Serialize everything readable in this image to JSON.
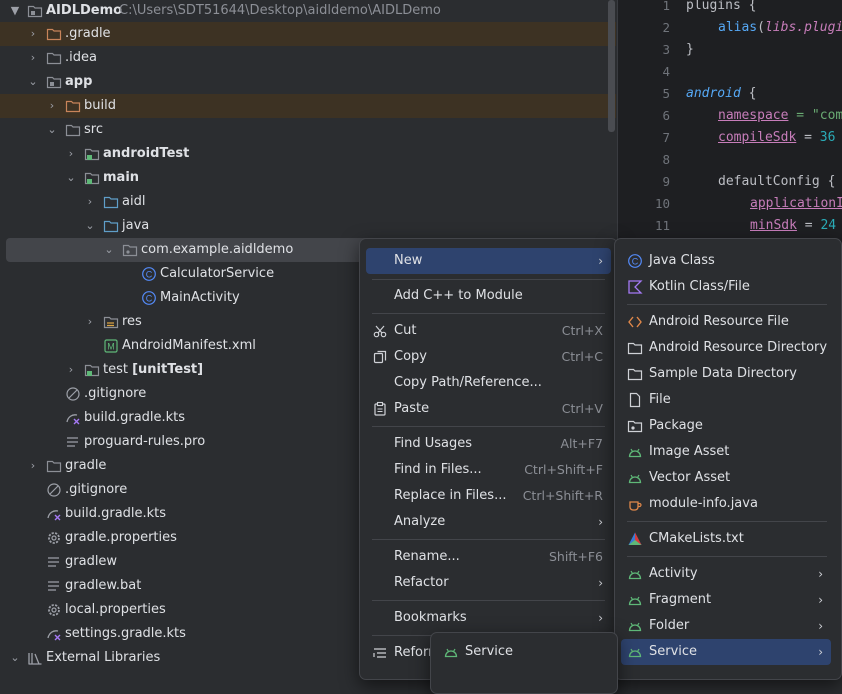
{
  "project_tree": {
    "root": {
      "name": "AIDLDemo",
      "path": "C:\\Users\\SDT51644\\Desktop\\aidldemo\\AIDLDemo"
    },
    "items": [
      {
        "label": ".gradle"
      },
      {
        "label": ".idea"
      },
      {
        "label": "app"
      },
      {
        "label": "build"
      },
      {
        "label": "src"
      },
      {
        "label": "androidTest"
      },
      {
        "label": "main"
      },
      {
        "label": "aidl"
      },
      {
        "label": "java"
      },
      {
        "label": "com.example.aidldemo"
      },
      {
        "label": "CalculatorService"
      },
      {
        "label": "MainActivity"
      },
      {
        "label": "res"
      },
      {
        "label": "AndroidManifest.xml"
      },
      {
        "label": "test",
        "suffix": "[unitTest]"
      },
      {
        "label": ".gitignore"
      },
      {
        "label": "build.gradle.kts"
      },
      {
        "label": "proguard-rules.pro"
      },
      {
        "label": "gradle"
      },
      {
        "label": ".gitignore"
      },
      {
        "label": "build.gradle.kts"
      },
      {
        "label": "gradle.properties"
      },
      {
        "label": "gradlew"
      },
      {
        "label": "gradlew.bat"
      },
      {
        "label": "local.properties"
      },
      {
        "label": "settings.gradle.kts"
      },
      {
        "label": "External Libraries"
      }
    ]
  },
  "editor": {
    "line_numbers": [
      "1",
      "2",
      "3",
      "4",
      "5",
      "6",
      "7",
      "8",
      "9",
      "10",
      "11"
    ],
    "code": {
      "l1": "plugins {",
      "l2_fn": "alias",
      "l2_arg": "libs.plugi",
      "l3": "}",
      "l5": "android",
      "l6_prop": "namespace",
      "l6_val": " = \"com",
      "l7_prop": "compileSdk",
      "l7_val": "36",
      "l9": "defaultConfig {",
      "l10_prop": "applicationI",
      "l11_prop": "minSdk",
      "l11_val": "24"
    }
  },
  "context_menu": {
    "new": "New",
    "add_cpp": "Add C++ to Module",
    "cut": "Cut",
    "cut_sc": "Ctrl+X",
    "copy": "Copy",
    "copy_sc": "Ctrl+C",
    "copy_path": "Copy Path/Reference...",
    "paste": "Paste",
    "paste_sc": "Ctrl+V",
    "find_usages": "Find Usages",
    "find_usages_sc": "Alt+F7",
    "find_in_files": "Find in Files...",
    "find_in_files_sc": "Ctrl+Shift+F",
    "replace_in_files": "Replace in Files...",
    "replace_in_files_sc": "Ctrl+Shift+R",
    "analyze": "Analyze",
    "rename": "Rename...",
    "rename_sc": "Shift+F6",
    "refactor": "Refactor",
    "bookmarks": "Bookmarks",
    "reformat": "Reform"
  },
  "new_submenu": {
    "java_class": "Java Class",
    "kotlin_class": "Kotlin Class/File",
    "android_resource_file": "Android Resource File",
    "android_resource_directory": "Android Resource Directory",
    "sample_data_directory": "Sample Data Directory",
    "file": "File",
    "package": "Package",
    "image_asset": "Image Asset",
    "vector_asset": "Vector Asset",
    "module_info": "module-info.java",
    "cmakelists": "CMakeLists.txt",
    "activity": "Activity",
    "fragment": "Fragment",
    "folder": "Folder",
    "service": "Service"
  },
  "service_submenu": {
    "service": "Service"
  },
  "colors": {
    "folder": "#8c8f96",
    "excluded_folder": "#c8845a",
    "source_folder": "#5f9ec8",
    "android_green": "#5fb878",
    "selection": "#2e436e",
    "class_icon": "#548af7",
    "kotlin": "#a57af5"
  }
}
